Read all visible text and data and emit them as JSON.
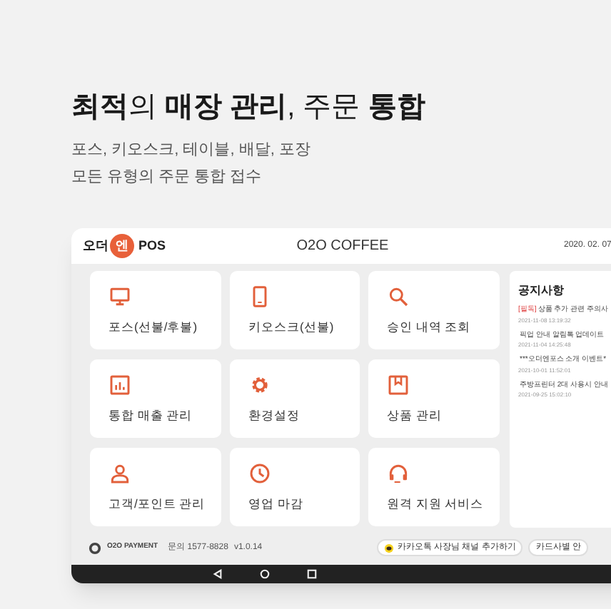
{
  "headline": "**최적**의 **매장 관리**, 주문 **통합**",
  "sublines": [
    "포스, 키오스크, 테이블, 배달, 포장",
    "모든 유형의 주문 통합 접수"
  ],
  "app_header": {
    "logo_left": "오더",
    "logo_mark": "엔",
    "logo_right": "POS",
    "store_name": "O2O COFFEE",
    "date": "2020. 02. 07"
  },
  "tiles": [
    {
      "kind": "monitor",
      "label": "포스(선불/후불)"
    },
    {
      "kind": "tablet",
      "label": "키오스크(선불)"
    },
    {
      "kind": "search",
      "label": "승인 내역 조회"
    },
    {
      "kind": "chart",
      "label": "통합 매출 관리"
    },
    {
      "kind": "gear",
      "label": "환경설정"
    },
    {
      "kind": "box",
      "label": "상품 관리"
    },
    {
      "kind": "person",
      "label": "고객/포인트 관리"
    },
    {
      "kind": "clock",
      "label": "영업 마감"
    },
    {
      "kind": "headset",
      "label": "원격 지원 서비스"
    }
  ],
  "notices": {
    "title": "공지사항",
    "items": [
      {
        "tag": "[필독]",
        "title": "상품 추가 관련 주의사",
        "date": "2021-11-08 13:19:32"
      },
      {
        "title": "픽업 안내 알림톡 업데이트",
        "date": "2021-11-04 14:25:48"
      },
      {
        "title": "***오더엔포스 소개 이벤트*",
        "date": "2021-10-01 11:52:01"
      },
      {
        "title": "주방프린터 2대 사용시 안내",
        "date": "2021-09-25 15:02:10"
      }
    ]
  },
  "footer": {
    "brand": "O2O PAYMENT",
    "contact": "문의 1577-8828",
    "version": "v1.0.14",
    "buttons": [
      {
        "kind": "kakao",
        "label": "카카오톡 사장님 채널 추가하기"
      },
      {
        "kind": "plain",
        "label": "카드사별 안"
      }
    ]
  }
}
